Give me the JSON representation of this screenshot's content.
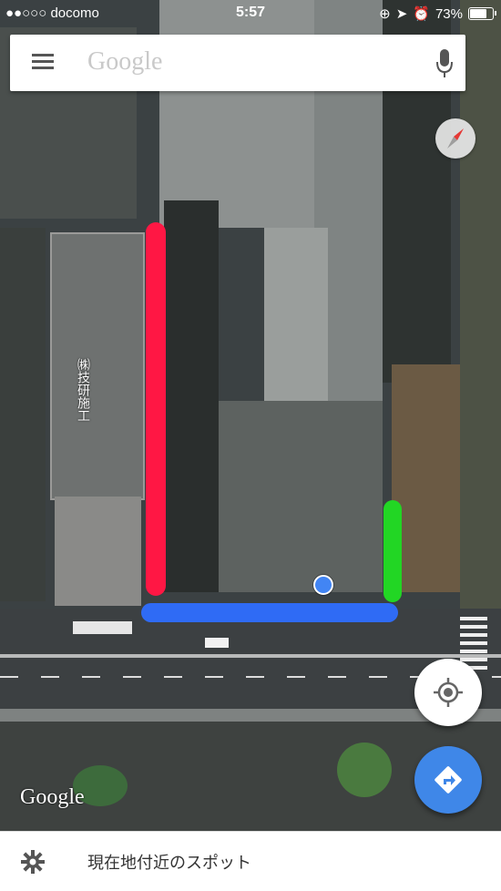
{
  "status_bar": {
    "carrier": "●●○○○ docomo",
    "time": "5:57",
    "battery": "73%"
  },
  "search": {
    "placeholder_logo": "Google"
  },
  "map": {
    "watermark": "Google",
    "building_label": "㈱技研施工",
    "markers": {
      "red_line_color": "#ff1744",
      "green_line_color": "#22d624",
      "blue_line_color": "#2f6bf5"
    }
  },
  "bottom_sheet": {
    "label": "現在地付近のスポット"
  },
  "colors": {
    "accent": "#3f87e8",
    "compass_needle": "#e53935"
  },
  "icons": [
    "menu-icon",
    "microphone-icon",
    "compass-icon",
    "my-location-icon",
    "directions-icon",
    "gear-icon"
  ]
}
